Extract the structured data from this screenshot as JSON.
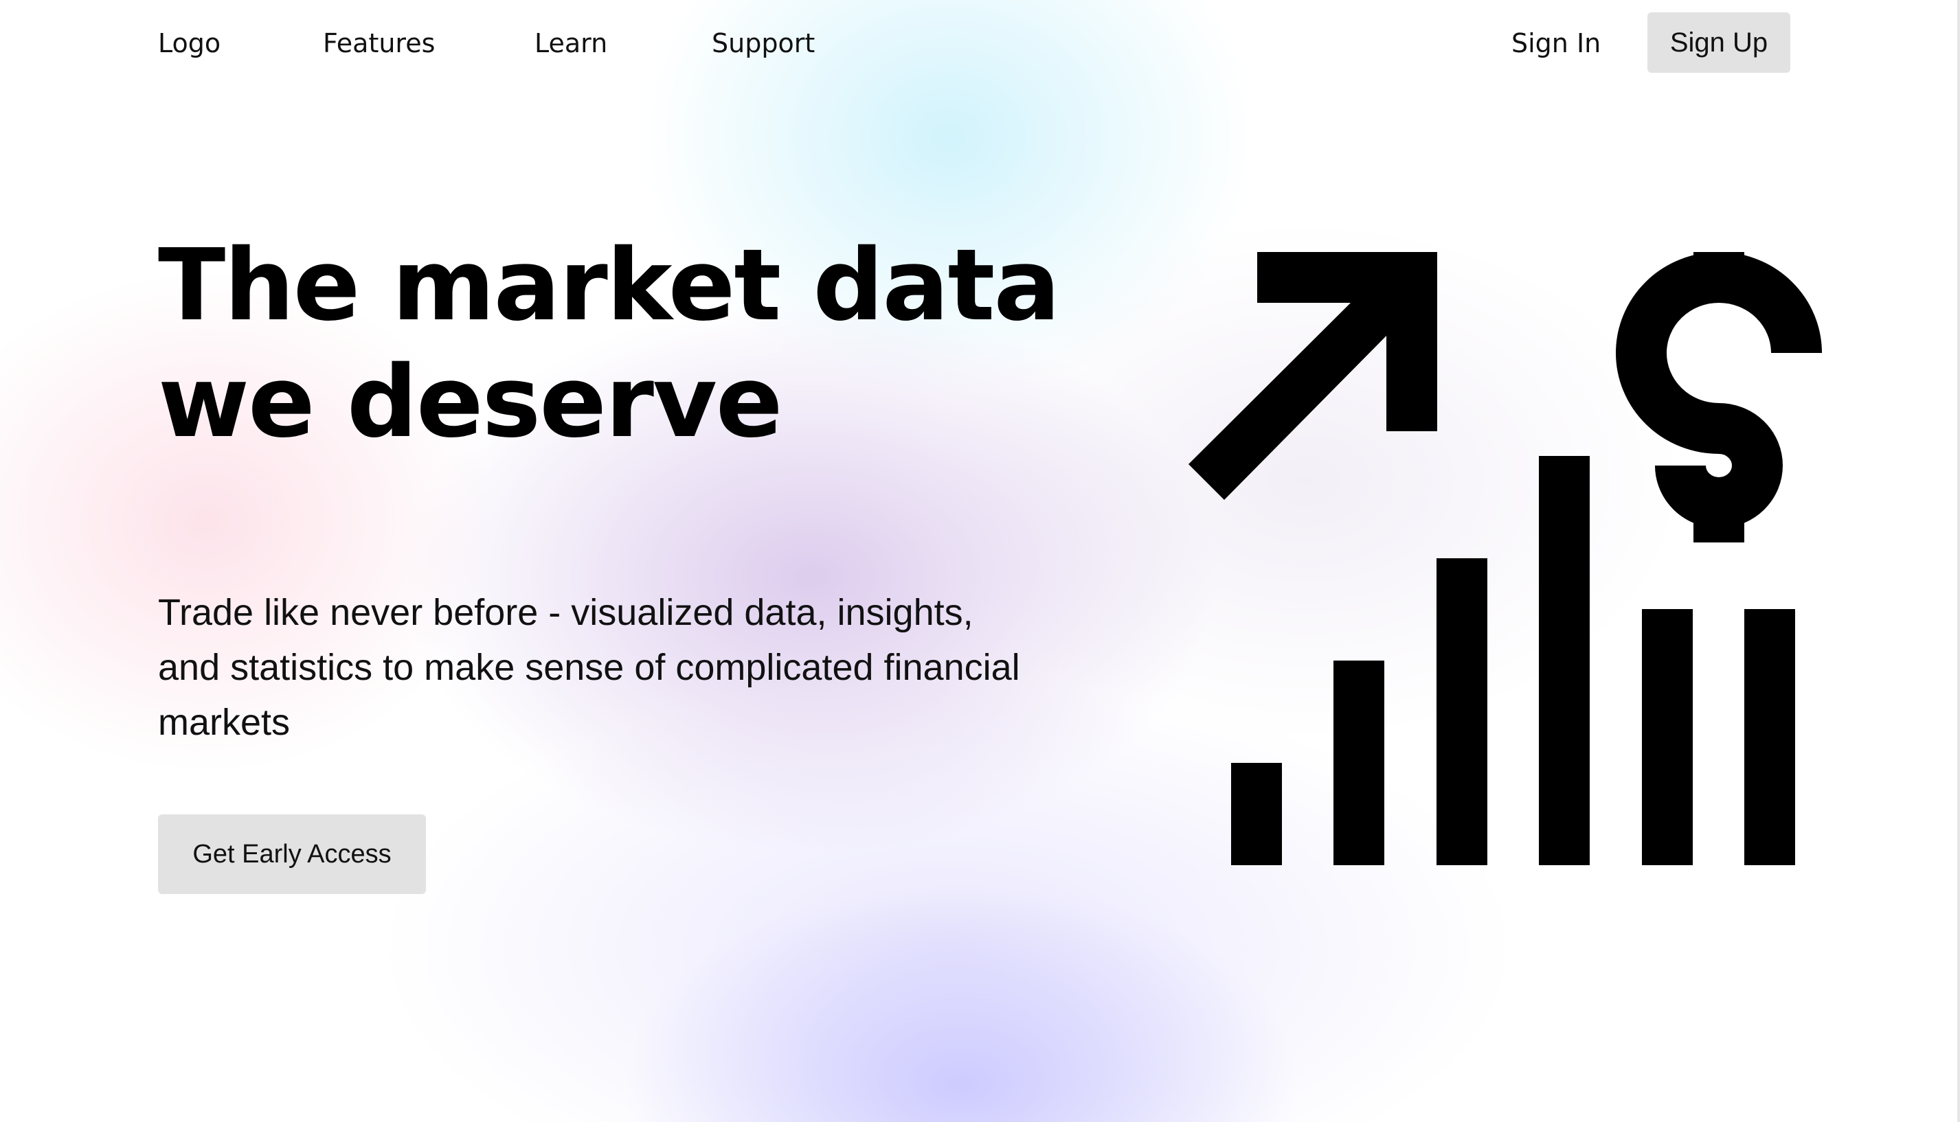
{
  "nav": {
    "logo": "Logo",
    "links": [
      "Features",
      "Learn",
      "Support"
    ],
    "sign_in": "Sign In",
    "sign_up": "Sign Up"
  },
  "hero": {
    "title_line1": "The market data",
    "title_line2": "we deserve",
    "subtitle": "Trade like never before - visualized data, insights, and statistics to make sense of complicated financial markets",
    "cta_label": "Get Early Access"
  },
  "illustration": {
    "icons": [
      "trend-up-arrow-icon",
      "dollar-sign-icon",
      "bar-chart-icon"
    ],
    "bar_levels": [
      0.25,
      0.5,
      0.75,
      1.0,
      0.625,
      0.625
    ],
    "color": "#000000"
  },
  "colors": {
    "button_bg": "#e2e2e2",
    "text": "#111111",
    "glow_blue": "#cdf2fc",
    "glow_pink": "#fcdae4",
    "glow_purple": "#d2bce8",
    "glow_lavender": "#c6c4ff"
  }
}
